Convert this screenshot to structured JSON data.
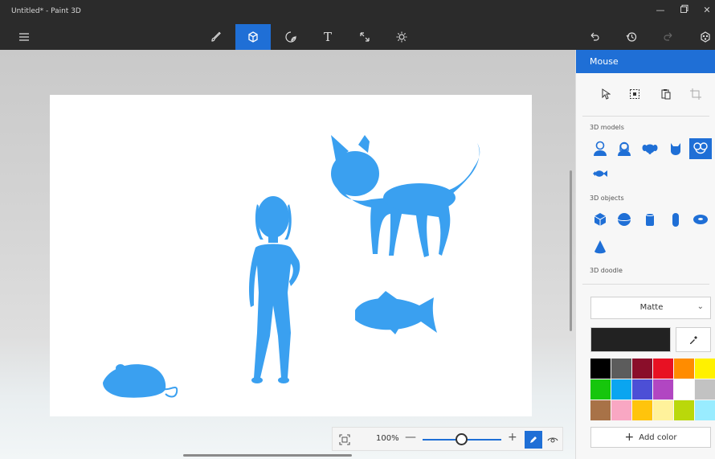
{
  "window": {
    "title": "Untitled* - Paint 3D",
    "controls": [
      "minimize",
      "restore",
      "close"
    ]
  },
  "toolbar": {
    "left": [
      {
        "icon": "hamburger-menu-icon"
      }
    ],
    "center": [
      {
        "icon": "brush-icon",
        "active": false
      },
      {
        "icon": "3d-cube-icon",
        "active": true
      },
      {
        "icon": "sticker-icon",
        "active": false
      },
      {
        "icon": "text-icon",
        "label": "T",
        "active": false
      },
      {
        "icon": "canvas-resize-icon",
        "active": false
      },
      {
        "icon": "effects-sun-icon",
        "active": false
      }
    ],
    "right": [
      {
        "icon": "undo-icon"
      },
      {
        "icon": "history-icon"
      },
      {
        "icon": "redo-icon",
        "disabled": true
      },
      {
        "icon": "remix3d-icon"
      }
    ]
  },
  "canvas": {
    "objects": [
      "woman-model",
      "cat-model",
      "fish-model",
      "mouse-model"
    ],
    "object_color": "#3aa0f0"
  },
  "zoom": {
    "value": "100%",
    "minus": "—",
    "plus": "+"
  },
  "panel": {
    "title": "Mouse",
    "selection_tools": [
      "cursor-select-icon",
      "select-region-icon",
      "paste-icon",
      "crop-icon"
    ],
    "sections": {
      "models": "3D models",
      "objects": "3D objects",
      "doodle": "3D doodle"
    },
    "models": [
      {
        "icon": "man-model-icon"
      },
      {
        "icon": "woman-model-icon"
      },
      {
        "icon": "dog-model-icon"
      },
      {
        "icon": "cat-model-icon"
      },
      {
        "icon": "fish-mouse-model-icon",
        "active": true
      },
      {
        "icon": "fish-model-icon"
      }
    ],
    "objects": [
      {
        "icon": "cube-icon"
      },
      {
        "icon": "sphere-icon"
      },
      {
        "icon": "cylinder-icon"
      },
      {
        "icon": "capsule-icon"
      },
      {
        "icon": "donut-icon"
      },
      {
        "icon": "cone-icon"
      }
    ],
    "material": {
      "value": "Matte"
    },
    "current_color": "#222222",
    "palette": [
      "#000000",
      "#5c5c5c",
      "#8a0e2a",
      "#e81123",
      "#ff8c00",
      "#fff100",
      "#16c60c",
      "#0aa5f0",
      "#4c4fd6",
      "#b146c2",
      "#ffffff",
      "#c2c2c2",
      "#a87247",
      "#f9a7c3",
      "#ffc40c",
      "#fff29b",
      "#bad80a",
      "#99ecff"
    ],
    "add_color_label": "Add color"
  }
}
